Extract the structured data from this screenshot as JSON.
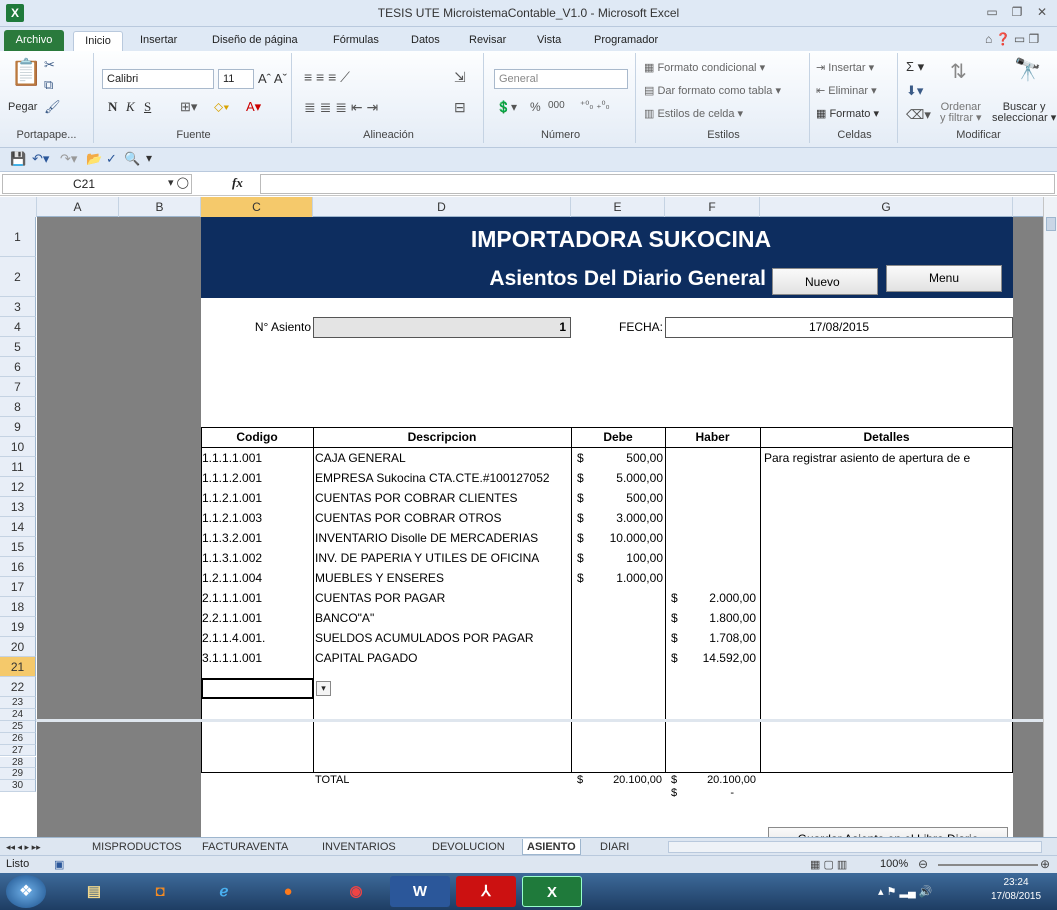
{
  "window": {
    "title": "TESIS UTE MicroistemaContable_V1.0 - Microsoft Excel",
    "app_icon": "X"
  },
  "ribbon_tabs": [
    "Archivo",
    "Inicio",
    "Insertar",
    "Diseño de página",
    "Fórmulas",
    "Datos",
    "Revisar",
    "Vista",
    "Programador"
  ],
  "ribbon": {
    "clipboard": {
      "label": "Portapape...",
      "paste": "Pegar"
    },
    "font": {
      "label": "Fuente",
      "name": "Calibri",
      "size": "11",
      "bold": "N",
      "italic": "K",
      "underline": "S"
    },
    "alignment": {
      "label": "Alineación"
    },
    "number": {
      "label": "Número",
      "format": "General",
      "percent": "%",
      "thousands": "000"
    },
    "styles": {
      "label": "Estilos",
      "conditional": "Formato condicional",
      "table": "Dar formato como tabla",
      "cell_styles": "Estilos de celda"
    },
    "cells": {
      "label": "Celdas",
      "insert": "Insertar",
      "delete": "Eliminar",
      "format": "Formato"
    },
    "editing": {
      "label": "Modificar",
      "sort": "Ordenar",
      "filter": "y filtrar",
      "find": "Buscar y",
      "select": "seleccionar"
    }
  },
  "formula_bar": {
    "name_box": "C21",
    "fx": "fx",
    "formula": ""
  },
  "columns": [
    "A",
    "B",
    "C",
    "D",
    "E",
    "F",
    "G"
  ],
  "rows": [
    "1",
    "2",
    "3",
    "4",
    "5",
    "6",
    "7",
    "8",
    "9",
    "10",
    "11",
    "12",
    "13",
    "14",
    "15",
    "16",
    "17",
    "18",
    "19",
    "20",
    "21",
    "22",
    "23",
    "24",
    "25",
    "26",
    "27",
    "28",
    "29",
    "30"
  ],
  "sheet": {
    "company": "IMPORTADORA SUKOCINA",
    "subtitle": "Asientos Del Diario General",
    "btn_new": "Nuevo",
    "btn_menu": "Menu",
    "asiento_label": "N° Asiento",
    "asiento_value": "1",
    "fecha_label": "FECHA:",
    "fecha_value": "17/08/2015",
    "headers": {
      "codigo": "Codigo",
      "descripcion": "Descripcion",
      "debe": "Debe",
      "haber": "Haber",
      "detalles": "Detalles"
    },
    "entries": [
      {
        "codigo": "1.1.1.1.001",
        "descripcion": "CAJA GENERAL",
        "debe": "500,00",
        "haber": "",
        "detalles": "Para registrar asiento de apertura de e"
      },
      {
        "codigo": "1.1.1.2.001",
        "descripcion": "EMPRESA Sukocina  CTA.CTE.#100127052",
        "debe": "5.000,00",
        "haber": "",
        "detalles": ""
      },
      {
        "codigo": "1.1.2.1.001",
        "descripcion": "CUENTAS POR COBRAR CLIENTES",
        "debe": "500,00",
        "haber": "",
        "detalles": ""
      },
      {
        "codigo": "1.1.2.1.003",
        "descripcion": "CUENTAS POR COBRAR OTROS",
        "debe": "3.000,00",
        "haber": "",
        "detalles": ""
      },
      {
        "codigo": "1.1.3.2.001",
        "descripcion": "INVENTARIO Disolle DE MERCADERIAS",
        "debe": "10.000,00",
        "haber": "",
        "detalles": ""
      },
      {
        "codigo": "1.1.3.1.002",
        "descripcion": "INV. DE PAPERIA Y UTILES  DE OFICINA",
        "debe": "100,00",
        "haber": "",
        "detalles": ""
      },
      {
        "codigo": "1.2.1.1.004",
        "descripcion": "MUEBLES Y ENSERES",
        "debe": "1.000,00",
        "haber": "",
        "detalles": ""
      },
      {
        "codigo": "2.1.1.1.001",
        "descripcion": "CUENTAS POR PAGAR",
        "debe": "",
        "haber": "2.000,00",
        "detalles": ""
      },
      {
        "codigo": "2.2.1.1.001",
        "descripcion": "BANCO\"A\"",
        "debe": "",
        "haber": "1.800,00",
        "detalles": ""
      },
      {
        "codigo": "2.1.1.4.001.",
        "descripcion": "SUELDOS ACUMULADOS POR PAGAR",
        "debe": "",
        "haber": "1.708,00",
        "detalles": ""
      },
      {
        "codigo": "3.1.1.1.001",
        "descripcion": "CAPITAL PAGADO",
        "debe": "",
        "haber": "14.592,00",
        "detalles": ""
      }
    ],
    "currency": "$",
    "total_label": "TOTAL",
    "total_debe": "20.100,00",
    "total_haber": "20.100,00",
    "difference": "-",
    "btn_save": "Guardar Asiento en el Libro Diario"
  },
  "sheet_tabs": [
    "MISPRODUCTOS",
    "FACTURAVENTA",
    "INVENTARIOS",
    "DEVOLUCION",
    "ASIENTO",
    "DIARI"
  ],
  "status": {
    "ready": "Listo",
    "zoom": "100%"
  },
  "taskbar": {
    "time": "23:24",
    "date": "17/08/2015"
  }
}
